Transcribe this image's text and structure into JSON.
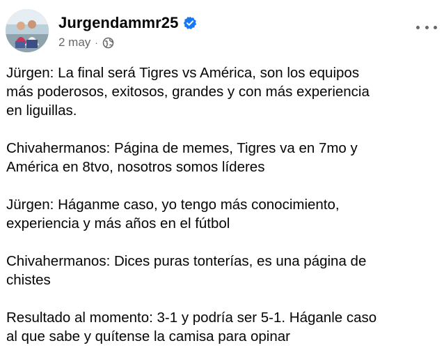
{
  "post": {
    "author": "Jurgendammr25",
    "date": "2 may",
    "separator": "·",
    "audience_icon": "globe-icon",
    "verified_icon": "verified-badge-icon",
    "more_icon": "more-options-icon",
    "accent_color": "#1877f2",
    "paragraphs": [
      "Jürgen: La final será Tigres vs América, son los equipos\nmás poderosos, exitosos, grandes y con más experiencia\nen liguillas.",
      "Chivahermanos: Página de memes, Tigres va en 7mo y\nAmérica en 8tvo, nosotros somos líderes",
      "Jürgen: Háganme caso, yo tengo más conocimiento,\nexperiencia y más años en el fútbol",
      "Chivahermanos: Dices puras tonterías, es una página de\nchistes",
      "Resultado al momento: 3-1 y podría ser 5-1. Háganle caso\nal que sabe y quítense la camisa para opinar"
    ]
  }
}
